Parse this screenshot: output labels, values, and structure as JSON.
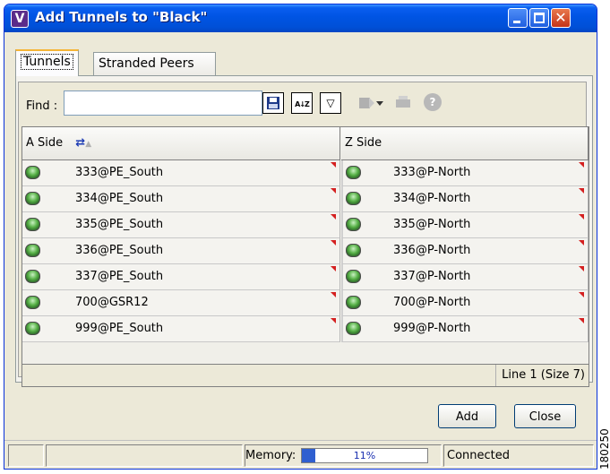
{
  "window": {
    "title": "Add Tunnels to \"Black\"",
    "app_icon_letter": "V",
    "close_glyph": "✕"
  },
  "tabs": [
    {
      "label": "Tunnels",
      "active": true
    },
    {
      "label": "Stranded Peers",
      "active": false
    }
  ],
  "toolbar": {
    "find_label": "Find :",
    "find_value": "",
    "tool_sort_glyph": "A↓Z",
    "tool_filter_glyph": "▽",
    "tool_help_glyph": "?"
  },
  "table": {
    "columns": [
      "A Side",
      "Z Side"
    ],
    "rows": [
      {
        "a": "333@PE_South",
        "z": "333@P-North"
      },
      {
        "a": "334@PE_South",
        "z": "334@P-North"
      },
      {
        "a": "335@PE_South",
        "z": "335@P-North"
      },
      {
        "a": "336@PE_South",
        "z": "336@P-North"
      },
      {
        "a": "337@PE_South",
        "z": "337@P-North"
      },
      {
        "a": "700@GSR12",
        "z": "700@P-North"
      },
      {
        "a": "999@PE_South",
        "z": "999@P-North"
      }
    ],
    "status": "Line 1 (Size 7)"
  },
  "buttons": {
    "add": "Add",
    "close": "Close"
  },
  "statusbar": {
    "memory_label": "Memory:",
    "memory_percent_text": "11%",
    "memory_fraction": 0.11,
    "connection": "Connected"
  },
  "watermark": "180250",
  "colors": {
    "title_bar": "#0054e3",
    "memory_fill": "#2f5fd0",
    "flag": "#d42020"
  }
}
